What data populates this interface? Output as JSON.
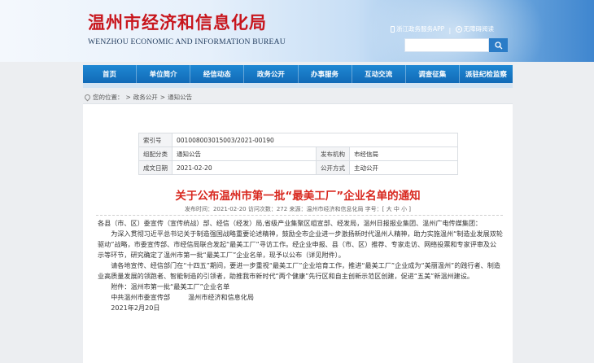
{
  "header": {
    "title_cn": "温州市经济和信息化局",
    "title_en": "WENZHOU ECONOMIC AND INFORMATION BUREAU",
    "links": [
      "浙江政务服务APP",
      "无障碍阅读"
    ],
    "search_placeholder": ""
  },
  "nav": [
    "首页",
    "单位简介",
    "经信动态",
    "政务公开",
    "办事服务",
    "互动交流",
    "调查征集",
    "派驻纪检监察"
  ],
  "breadcrumb": {
    "label": "您的位置：",
    "items": [
      "政务公开",
      "通知公告"
    ],
    "sep": ">"
  },
  "meta": {
    "index_key": "索引号",
    "index_val": "001008003015003/2021-00190",
    "category_key": "组配分类",
    "category_val": "通知公告",
    "publisher_key": "发布机构",
    "publisher_val": "市经信局",
    "date_key": "成文日期",
    "date_val": "2021-02-20",
    "method_key": "公开方式",
    "method_val": "主动公开"
  },
  "article": {
    "title": "关于公布温州市第一批“最美工厂”企业名单的通知",
    "info": "发布时间：2021-02-20  访问次数：272  来源：温州市经济和信息化局  字号：[ 大 中 小 ]",
    "salutation": "各县（市、区）委宣传（宣传统战）部、经信（经发）局,省级产业集聚区组宣部、经发局，温州日报报业集团、温州广电传媒集团：",
    "para1": "为深入贯彻习近平总书记关于制造强国战略重要论述精神，鼓励全市企业进一步激扬新时代温州人精神，助力实施温州“制造业发展双轮驱动”战略，市委宣传部、市经信局联合发起“最美工厂”寻访工作。经企业申报、县（市、区）推荐、专家走访、网络投票和专家评审及公示等环节，研究确定了温州市第一批“最美工厂”企业名单，现予以公布（详见附件）。",
    "para2": "请各地宣传、经信部门在“十四五”期间，要进一步重视“最美工厂”企业培育工作，推进“最美工厂”企业成为“美丽温州”的践行者、制造业高质量发展的领跑者、智能制造的引领者，助推我市新时代“两个健康”先行区和自主创新示范区创建，促进“五美”新温州建设。",
    "attachment": "附件：温州市第一批“最美工厂”企业名单",
    "sign1": "中共温州市委宣传部",
    "sign2": "温州市经济和信息化局",
    "date": "2021年2月20日"
  }
}
